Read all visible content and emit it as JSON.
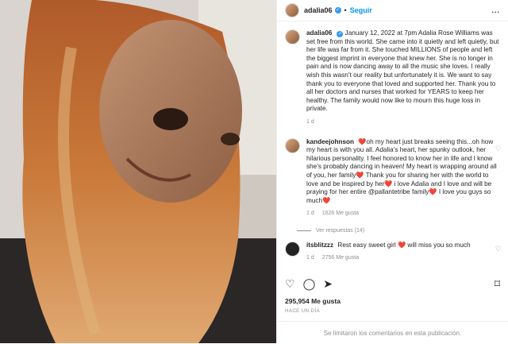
{
  "header": {
    "username": "adalia06",
    "follow_label": "Seguir",
    "more_label": "..."
  },
  "caption": {
    "username": "adalia06",
    "text": "January 12, 2022 at 7pm Adalia Rose Williams was set free from this world. She came into it quietly and left quietly, but her life was far from it. She touched MILLIONS of people and left the biggest imprint in everyone that knew her. She is no longer in pain and is now dancing away to all the music she loves. I really wish this wasn’t our reality but unfortunately it is. We want to say thank you to everyone that loved and supported her. Thank you to all her doctors and nurses that worked for YEARS to keep her healthy. The family would now like to mourn this huge loss in private.",
    "time": "1 d"
  },
  "comments": [
    {
      "username": "kandeejohnson",
      "text": "❤️oh my heart just breaks seeing this...oh how my heart is with you all. Adalia’s heart, her spunky outlook, her hilarious personality. I feel honored to know her in life and I know she’s probably dancing in heaven! My heart is wrapping around all of you, her family❤️ Thank you for sharing her with the world to love and be inspired by her❤️ i love Adalia and I love and will be praying for her entire @pallantetribe family❤️ I love you guys so much❤️",
      "time": "1 d",
      "likes": "1626 Me gusta",
      "replies": "Ver respuestas (14)"
    },
    {
      "username": "itsblitzzz",
      "text": "Rest easy sweet girl ❤️ will miss you so much",
      "time": "1 d",
      "likes": "2756 Me gusta"
    }
  ],
  "likes_count": "295,954 Me gusta",
  "post_date": "HACE UN DÍA",
  "footer_notice": "Se limitaron los comentarios en esta publicación.",
  "icons": {
    "like": "heart-icon",
    "comment": "comment-icon",
    "share": "share-icon",
    "save": "bookmark-icon"
  },
  "colors": {
    "accent": "#0095f6",
    "verified": "#3897f0",
    "heart": "#e0245e"
  }
}
